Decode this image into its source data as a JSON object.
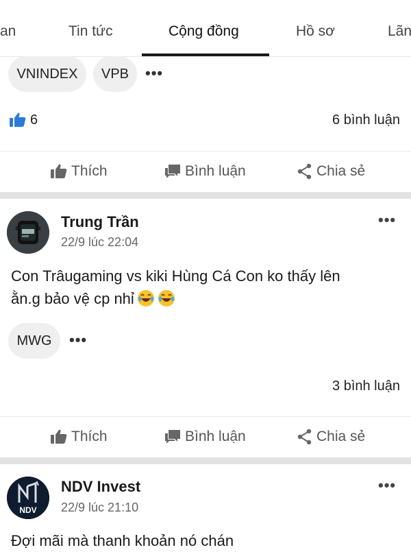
{
  "tabs": [
    "an",
    "Tin tức",
    "Cộng đồng",
    "Hồ sơ",
    "Lãn"
  ],
  "post1": {
    "tags": [
      "VNINDEX",
      "VPB"
    ],
    "like_count": "6",
    "comments": "6 bình luận"
  },
  "actions": {
    "like": "Thích",
    "comment": "Bình luận",
    "share": "Chia sẻ"
  },
  "post2": {
    "author": "Trung Trần",
    "time": "22/9 lúc 22:04",
    "content_line1": "Con Trâugaming vs kiki Hùng Cá Con ko thấy lên",
    "content_line2": "ằn.g bảo vệ cp nhỉ",
    "tags": [
      "MWG"
    ],
    "comments": "3 bình luận",
    "avatar_icon": "smartwatch-avatar"
  },
  "post3": {
    "author": "NDV Invest",
    "time": "22/9 lúc 21:10",
    "content_line1": "Đợi mãi mà thanh khoản nó chán",
    "avatar_label": "NDV"
  },
  "more_glyph": "•••",
  "colors": {
    "like_blue": "#2d7bd8",
    "separator": "#e3e3e3",
    "tag_bg": "#efefef"
  }
}
